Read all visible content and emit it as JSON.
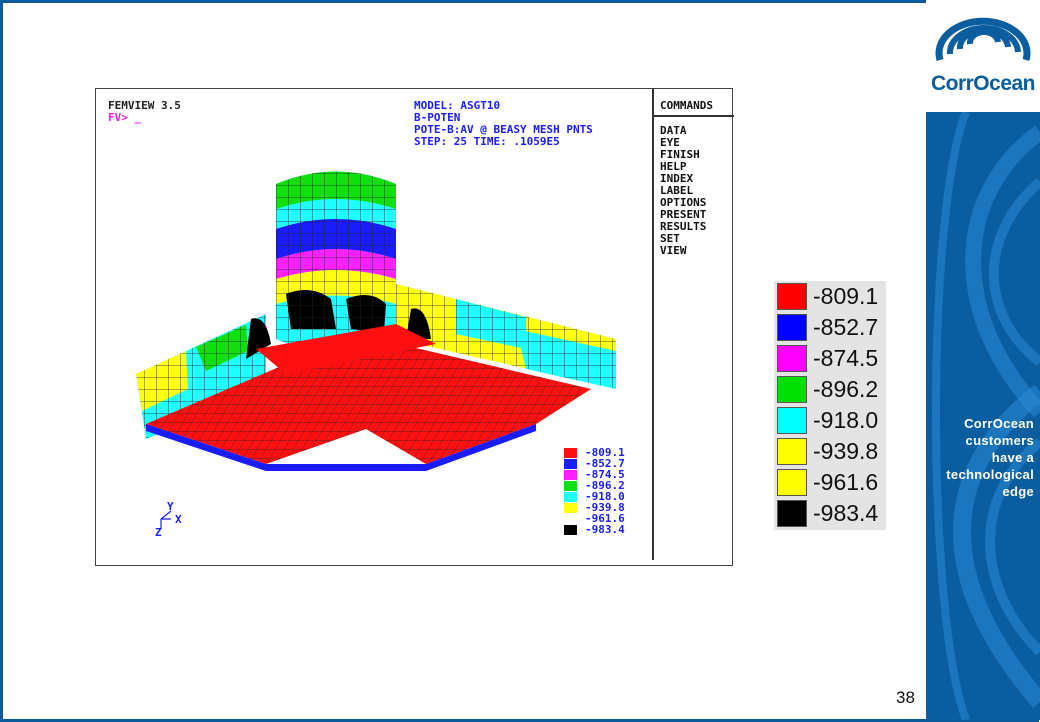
{
  "brand": {
    "logo_text": "CorrOcean",
    "tagline": [
      "CorrOcean",
      "customers",
      "have a",
      "technological",
      "edge"
    ],
    "colors": {
      "primary": "#0a5d9f"
    }
  },
  "femview": {
    "header_left": [
      "FEMVIEW 3.5",
      "FV> _"
    ],
    "header_right": [
      "MODEL: ASGT10",
      "B-POTEN",
      "POTE-B:AV @ BEASY MESH PNTS",
      "STEP: 25    TIME: .1059E5"
    ],
    "commands_title": "COMMANDS",
    "commands": [
      "DATA",
      "EYE",
      "FINISH",
      "HELP",
      "INDEX",
      "LABEL",
      "OPTIONS",
      "PRESENT",
      "RESULTS",
      "SET",
      "VIEW"
    ],
    "axes": {
      "y": "Y",
      "x": "X",
      "z": "Z"
    },
    "legend": [
      {
        "value": "-809.1",
        "color": "#ff1010"
      },
      {
        "value": "-852.7",
        "color": "#1b1bff"
      },
      {
        "value": "-874.5",
        "color": "#ff20ff"
      },
      {
        "value": "-896.2",
        "color": "#10e010"
      },
      {
        "value": "-918.0",
        "color": "#20ffff"
      },
      {
        "value": "-939.8",
        "color": "#ffff10"
      },
      {
        "value": "-961.6",
        "color": "#000000"
      },
      {
        "value": "-983.4",
        "color": "#000000"
      }
    ]
  },
  "big_legend": [
    {
      "value": "-809.1",
      "color": "#ff0000"
    },
    {
      "value": "-852.7",
      "color": "#0000ff"
    },
    {
      "value": "-874.5",
      "color": "#ff00ff"
    },
    {
      "value": "-896.2",
      "color": "#00e000"
    },
    {
      "value": "-918.0",
      "color": "#00ffff"
    },
    {
      "value": "-939.8",
      "color": "#ffff00"
    },
    {
      "value": "-961.6",
      "color": "#000000"
    },
    {
      "value": "-983.4",
      "color": "#000000"
    }
  ],
  "page_number": "38"
}
